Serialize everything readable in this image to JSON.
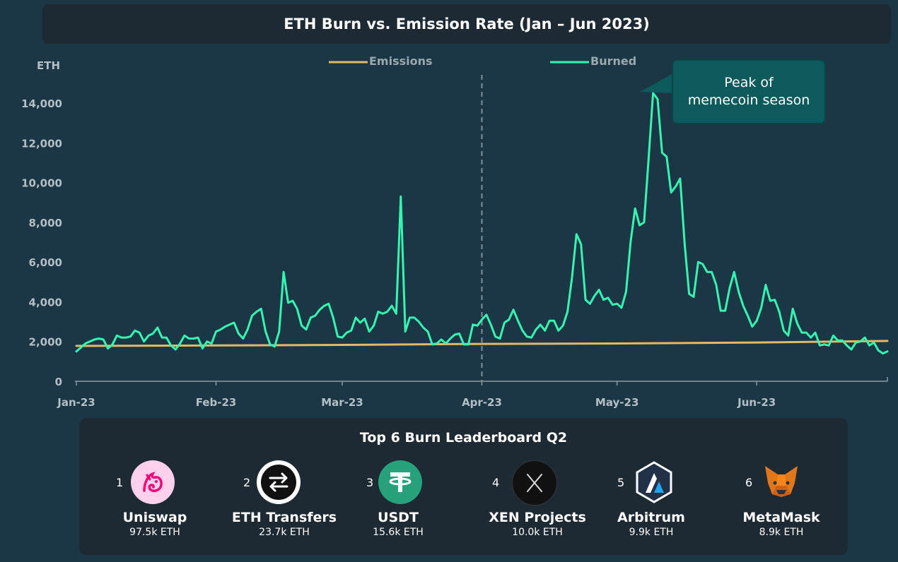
{
  "chart_data": {
    "type": "line",
    "title": "ETH Burn vs. Emission Rate (Jan – Jun 2023)",
    "ylabel": "ETH",
    "ylim": [
      0,
      14000
    ],
    "yticks": [
      "0",
      "2,000",
      "4,000",
      "6,000",
      "8,000",
      "10,000",
      "12,000",
      "14,000"
    ],
    "x_tick_labels": [
      "Jan-23",
      "Feb-23",
      "Mar-23",
      "Apr-23",
      "May-23",
      "Jun-23"
    ],
    "x_ticks": [
      "2023-01-01",
      "2023-02-01",
      "2023-03-01",
      "2023-04-01",
      "2023-05-01",
      "2023-06-01"
    ],
    "xlim": [
      "2023-01-01",
      "2023-06-30"
    ],
    "grid": false,
    "legend_position": "top",
    "vline": {
      "date": "2023-04-01",
      "style": "dashed"
    },
    "annotation": {
      "text": "Peak of memecoin season",
      "date": "2023-05-05",
      "value": 14500
    },
    "series": [
      {
        "name": "Emissions",
        "color": "#e2b964",
        "points": [
          [
            "2023-01-01",
            1780
          ],
          [
            "2023-02-01",
            1800
          ],
          [
            "2023-03-01",
            1830
          ],
          [
            "2023-04-01",
            1880
          ],
          [
            "2023-05-01",
            1900
          ],
          [
            "2023-06-01",
            1950
          ],
          [
            "2023-06-30",
            2030
          ]
        ]
      },
      {
        "name": "Burned",
        "color": "#35f5b0",
        "points": [
          [
            "2023-01-01",
            1500
          ],
          [
            "2023-01-02",
            1700
          ],
          [
            "2023-01-03",
            1900
          ],
          [
            "2023-01-04",
            2000
          ],
          [
            "2023-01-05",
            2100
          ],
          [
            "2023-01-06",
            2150
          ],
          [
            "2023-01-07",
            2100
          ],
          [
            "2023-01-08",
            1650
          ],
          [
            "2023-01-09",
            1850
          ],
          [
            "2023-01-10",
            2300
          ],
          [
            "2023-01-11",
            2200
          ],
          [
            "2023-01-12",
            2200
          ],
          [
            "2023-01-13",
            2250
          ],
          [
            "2023-01-14",
            2550
          ],
          [
            "2023-01-15",
            2450
          ],
          [
            "2023-01-16",
            2000
          ],
          [
            "2023-01-17",
            2300
          ],
          [
            "2023-01-18",
            2400
          ],
          [
            "2023-01-19",
            2700
          ],
          [
            "2023-01-20",
            2200
          ],
          [
            "2023-01-21",
            2200
          ],
          [
            "2023-01-22",
            1800
          ],
          [
            "2023-01-23",
            1600
          ],
          [
            "2023-01-24",
            1900
          ],
          [
            "2023-01-25",
            2300
          ],
          [
            "2023-01-26",
            2150
          ],
          [
            "2023-01-27",
            2150
          ],
          [
            "2023-01-28",
            2200
          ],
          [
            "2023-01-29",
            1650
          ],
          [
            "2023-01-30",
            2000
          ],
          [
            "2023-01-31",
            1900
          ],
          [
            "2023-02-01",
            2500
          ],
          [
            "2023-02-02",
            2600
          ],
          [
            "2023-02-03",
            2750
          ],
          [
            "2023-02-04",
            2850
          ],
          [
            "2023-02-05",
            2950
          ],
          [
            "2023-02-06",
            2400
          ],
          [
            "2023-02-07",
            2150
          ],
          [
            "2023-02-08",
            2600
          ],
          [
            "2023-02-09",
            3300
          ],
          [
            "2023-02-10",
            3500
          ],
          [
            "2023-02-11",
            3650
          ],
          [
            "2023-02-12",
            2500
          ],
          [
            "2023-02-13",
            1850
          ],
          [
            "2023-02-14",
            1750
          ],
          [
            "2023-02-15",
            2500
          ],
          [
            "2023-02-16",
            5500
          ],
          [
            "2023-02-17",
            3950
          ],
          [
            "2023-02-18",
            4050
          ],
          [
            "2023-02-19",
            3650
          ],
          [
            "2023-02-20",
            2800
          ],
          [
            "2023-02-21",
            2600
          ],
          [
            "2023-02-22",
            3200
          ],
          [
            "2023-02-23",
            3300
          ],
          [
            "2023-02-24",
            3600
          ],
          [
            "2023-02-25",
            3800
          ],
          [
            "2023-02-26",
            3900
          ],
          [
            "2023-02-27",
            3200
          ],
          [
            "2023-02-28",
            2250
          ],
          [
            "2023-03-01",
            2200
          ],
          [
            "2023-03-02",
            2450
          ],
          [
            "2023-03-03",
            2550
          ],
          [
            "2023-03-04",
            3200
          ],
          [
            "2023-03-05",
            2950
          ],
          [
            "2023-03-06",
            3150
          ],
          [
            "2023-03-07",
            2500
          ],
          [
            "2023-03-08",
            2800
          ],
          [
            "2023-03-09",
            3500
          ],
          [
            "2023-03-10",
            3400
          ],
          [
            "2023-03-11",
            3500
          ],
          [
            "2023-03-12",
            3800
          ],
          [
            "2023-03-13",
            3400
          ],
          [
            "2023-03-14",
            9300
          ],
          [
            "2023-03-15",
            2500
          ],
          [
            "2023-03-16",
            3200
          ],
          [
            "2023-03-17",
            3200
          ],
          [
            "2023-03-18",
            3000
          ],
          [
            "2023-03-19",
            2700
          ],
          [
            "2023-03-20",
            2500
          ],
          [
            "2023-03-21",
            1850
          ],
          [
            "2023-03-22",
            1900
          ],
          [
            "2023-03-23",
            2100
          ],
          [
            "2023-03-24",
            1900
          ],
          [
            "2023-03-25",
            2150
          ],
          [
            "2023-03-26",
            2350
          ],
          [
            "2023-03-27",
            2400
          ],
          [
            "2023-03-28",
            1850
          ],
          [
            "2023-03-29",
            1850
          ],
          [
            "2023-03-30",
            2850
          ],
          [
            "2023-03-31",
            2800
          ],
          [
            "2023-04-01",
            3100
          ],
          [
            "2023-04-02",
            3350
          ],
          [
            "2023-04-03",
            2850
          ],
          [
            "2023-04-04",
            2250
          ],
          [
            "2023-04-05",
            2150
          ],
          [
            "2023-04-06",
            2950
          ],
          [
            "2023-04-07",
            3100
          ],
          [
            "2023-04-08",
            3600
          ],
          [
            "2023-04-09",
            3050
          ],
          [
            "2023-04-10",
            2550
          ],
          [
            "2023-04-11",
            2250
          ],
          [
            "2023-04-12",
            2200
          ],
          [
            "2023-04-13",
            2600
          ],
          [
            "2023-04-14",
            2850
          ],
          [
            "2023-04-15",
            2550
          ],
          [
            "2023-04-16",
            3050
          ],
          [
            "2023-04-17",
            3050
          ],
          [
            "2023-04-18",
            2550
          ],
          [
            "2023-04-19",
            2800
          ],
          [
            "2023-04-20",
            3500
          ],
          [
            "2023-04-21",
            5200
          ],
          [
            "2023-04-22",
            7400
          ],
          [
            "2023-04-23",
            6900
          ],
          [
            "2023-04-24",
            4100
          ],
          [
            "2023-04-25",
            3900
          ],
          [
            "2023-04-26",
            4300
          ],
          [
            "2023-04-27",
            4600
          ],
          [
            "2023-04-28",
            4100
          ],
          [
            "2023-04-29",
            4200
          ],
          [
            "2023-04-30",
            3850
          ],
          [
            "2023-05-01",
            3900
          ],
          [
            "2023-05-02",
            3700
          ],
          [
            "2023-05-03",
            4500
          ],
          [
            "2023-05-04",
            7000
          ],
          [
            "2023-05-05",
            8700
          ],
          [
            "2023-05-06",
            7850
          ],
          [
            "2023-05-07",
            8000
          ],
          [
            "2023-05-08",
            11200
          ],
          [
            "2023-05-09",
            14500
          ],
          [
            "2023-05-10",
            14200
          ],
          [
            "2023-05-11",
            11500
          ],
          [
            "2023-05-12",
            11300
          ],
          [
            "2023-05-13",
            9500
          ],
          [
            "2023-05-14",
            9800
          ],
          [
            "2023-05-15",
            10200
          ],
          [
            "2023-05-16",
            6900
          ],
          [
            "2023-05-17",
            4400
          ],
          [
            "2023-05-18",
            4250
          ],
          [
            "2023-05-19",
            6000
          ],
          [
            "2023-05-20",
            5900
          ],
          [
            "2023-05-21",
            5500
          ],
          [
            "2023-05-22",
            5500
          ],
          [
            "2023-05-23",
            4850
          ],
          [
            "2023-05-24",
            3550
          ],
          [
            "2023-05-25",
            3550
          ],
          [
            "2023-05-26",
            4700
          ],
          [
            "2023-05-27",
            5500
          ],
          [
            "2023-05-28",
            4500
          ],
          [
            "2023-05-29",
            3800
          ],
          [
            "2023-05-30",
            3300
          ],
          [
            "2023-05-31",
            2750
          ],
          [
            "2023-06-01",
            3050
          ],
          [
            "2023-06-02",
            3700
          ],
          [
            "2023-06-03",
            4850
          ],
          [
            "2023-06-04",
            4050
          ],
          [
            "2023-06-05",
            4100
          ],
          [
            "2023-06-06",
            3500
          ],
          [
            "2023-06-07",
            2550
          ],
          [
            "2023-06-08",
            2300
          ],
          [
            "2023-06-09",
            3650
          ],
          [
            "2023-06-10",
            2900
          ],
          [
            "2023-06-11",
            2450
          ],
          [
            "2023-06-12",
            2450
          ],
          [
            "2023-06-13",
            2200
          ],
          [
            "2023-06-14",
            2450
          ],
          [
            "2023-06-15",
            1800
          ],
          [
            "2023-06-16",
            1850
          ],
          [
            "2023-06-17",
            1800
          ],
          [
            "2023-06-18",
            2300
          ],
          [
            "2023-06-19",
            2050
          ],
          [
            "2023-06-20",
            2050
          ],
          [
            "2023-06-21",
            1800
          ],
          [
            "2023-06-22",
            1600
          ],
          [
            "2023-06-23",
            1950
          ],
          [
            "2023-06-24",
            2000
          ],
          [
            "2023-06-25",
            2200
          ],
          [
            "2023-06-26",
            1800
          ],
          [
            "2023-06-27",
            1950
          ],
          [
            "2023-06-28",
            1550
          ],
          [
            "2023-06-29",
            1400
          ],
          [
            "2023-06-30",
            1500
          ]
        ]
      }
    ]
  },
  "leaderboard": {
    "title": "Top 6 Burn Leaderboard Q2",
    "items": [
      {
        "rank": "1",
        "name": "Uniswap",
        "value": "97.5k ETH",
        "icon": "uniswap-icon"
      },
      {
        "rank": "2",
        "name": "ETH Transfers",
        "value": "23.7k ETH",
        "icon": "transfer-arrows-icon"
      },
      {
        "rank": "3",
        "name": "USDT",
        "value": "15.6k ETH",
        "icon": "tether-icon"
      },
      {
        "rank": "4",
        "name": "XEN Projects",
        "value": "10.0k ETH",
        "icon": "xen-icon"
      },
      {
        "rank": "5",
        "name": "Arbitrum",
        "value": "9.9k ETH",
        "icon": "arbitrum-icon"
      },
      {
        "rank": "6",
        "name": "MetaMask",
        "value": "8.9k ETH",
        "icon": "metamask-fox-icon"
      }
    ]
  }
}
